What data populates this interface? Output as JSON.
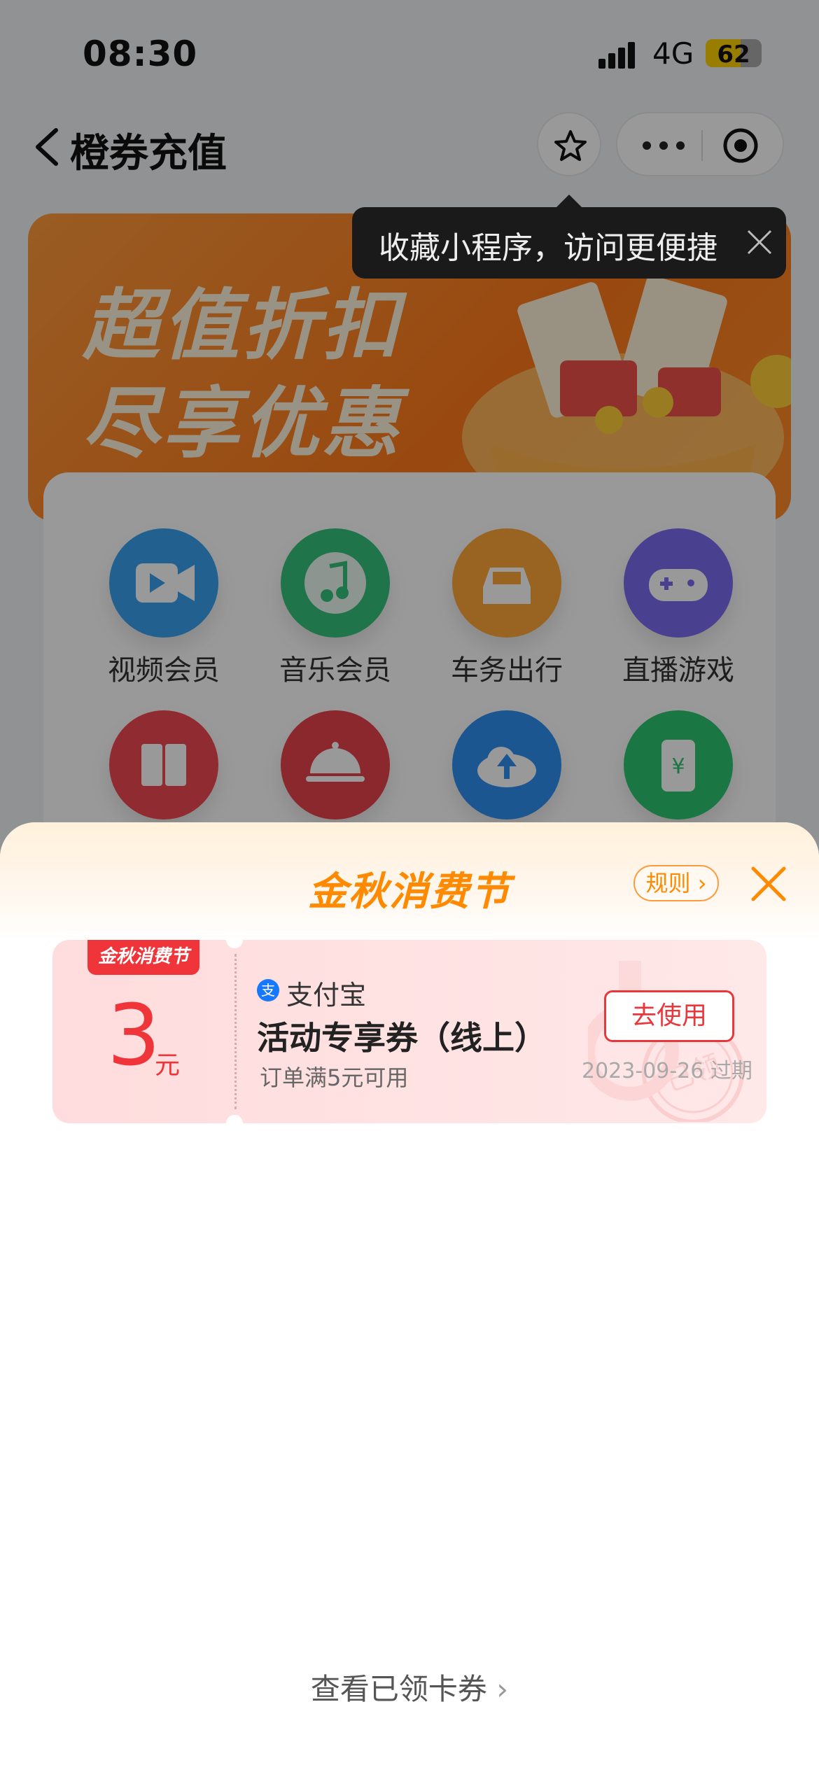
{
  "status_bar": {
    "time": "08:30",
    "network": "4G",
    "battery": "62",
    "battery_level": 0.62
  },
  "nav": {
    "title": "橙券充值"
  },
  "tooltip": {
    "text": "收藏小程序，访问更便捷"
  },
  "banner": {
    "line1": "超值折扣",
    "line2": "尽享优惠"
  },
  "grid": {
    "items": [
      {
        "label": "视频会员",
        "icon": "video-icon",
        "color": "#3aa0f0"
      },
      {
        "label": "音乐会员",
        "icon": "music-icon",
        "color": "#34c47a"
      },
      {
        "label": "车务出行",
        "icon": "car-icon",
        "color": "#ffa63a"
      },
      {
        "label": "直播游戏",
        "icon": "gamepad-icon",
        "color": "#7a6cf0"
      },
      {
        "label": "",
        "icon": "book-icon",
        "color": "#f04a52"
      },
      {
        "label": "",
        "icon": "food-cover-icon",
        "color": "#e8444c"
      },
      {
        "label": "",
        "icon": "cloud-upload-icon",
        "color": "#2f8ff0"
      },
      {
        "label": "",
        "icon": "phone-yuan-icon",
        "color": "#2cc56e"
      }
    ]
  },
  "sheet": {
    "title": "金秋消费节",
    "rules_label": "规则",
    "coupon": {
      "tag": "金秋消费节",
      "amount": "3",
      "unit": "元",
      "issuer": "支付宝",
      "name": "活动专享券（线上）",
      "condition": "订单满5元可用",
      "button": "去使用",
      "expiry": "2023-09-26 过期",
      "stamp": "已领"
    },
    "view_link": "查看已领卡券"
  },
  "colors": {
    "accent": "#ff8a00",
    "coupon_red": "#f0353a",
    "alipay_blue": "#1677ff"
  }
}
